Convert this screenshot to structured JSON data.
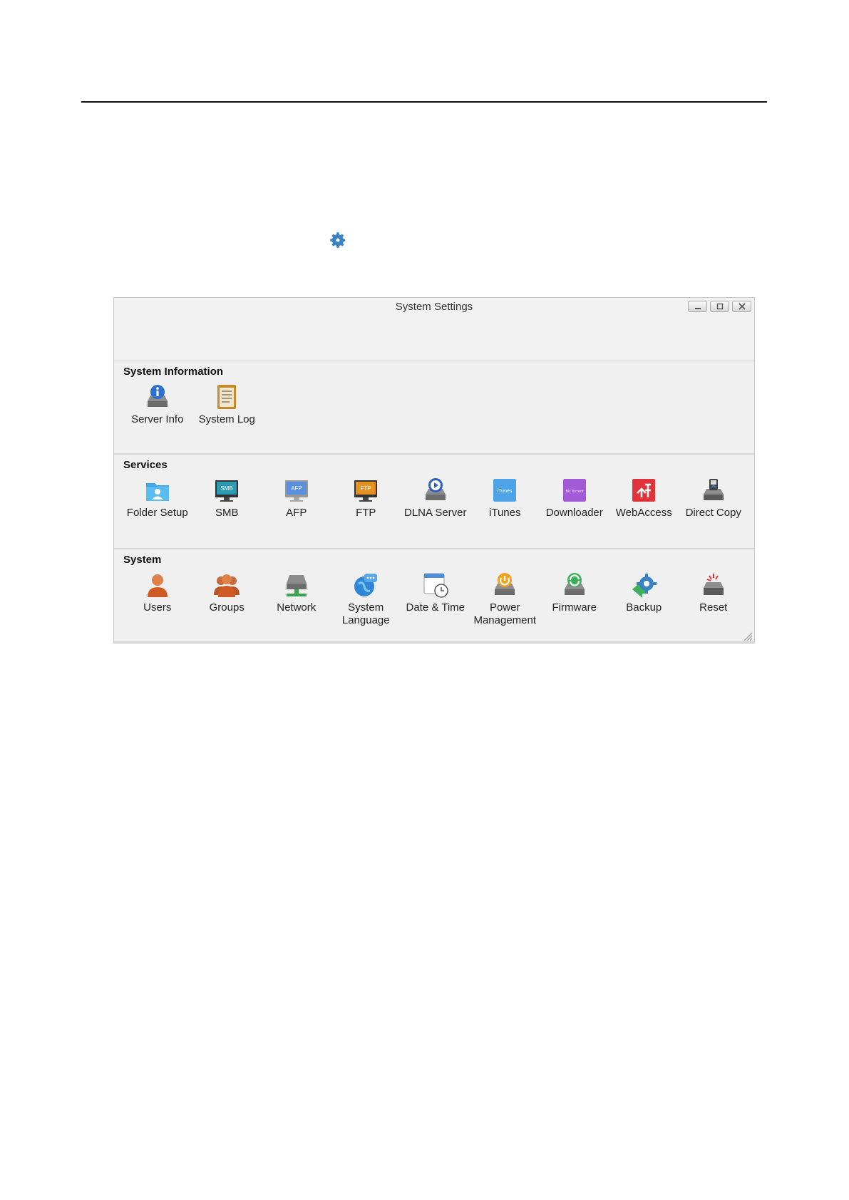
{
  "window": {
    "title": "System Settings",
    "controls": [
      "minimize",
      "maximize",
      "close"
    ]
  },
  "sections": {
    "system_information": {
      "title": "System Information",
      "items": [
        {
          "label": "Server Info",
          "icon": "server-info-icon"
        },
        {
          "label": "System Log",
          "icon": "system-log-icon"
        }
      ]
    },
    "services": {
      "title": "Services",
      "items": [
        {
          "label": "Folder Setup",
          "icon": "folder-setup-icon"
        },
        {
          "label": "SMB",
          "icon": "smb-icon",
          "icon_text": "SMB"
        },
        {
          "label": "AFP",
          "icon": "afp-icon",
          "icon_text": "AFP"
        },
        {
          "label": "FTP",
          "icon": "ftp-icon",
          "icon_text": "FTP"
        },
        {
          "label": "DLNA Server",
          "icon": "dlna-server-icon"
        },
        {
          "label": "iTunes",
          "icon": "itunes-icon",
          "icon_text": "iTunes"
        },
        {
          "label": "Downloader",
          "icon": "downloader-icon",
          "icon_text": "Bit Torrent"
        },
        {
          "label": "WebAccess",
          "icon": "webaccess-icon"
        },
        {
          "label": "Direct Copy",
          "icon": "direct-copy-icon"
        }
      ]
    },
    "system": {
      "title": "System",
      "items": [
        {
          "label": "Users",
          "icon": "users-icon"
        },
        {
          "label": "Groups",
          "icon": "groups-icon"
        },
        {
          "label": "Network",
          "icon": "network-icon"
        },
        {
          "label": "System Language",
          "label_lines": [
            "System",
            "Language"
          ],
          "icon": "system-language-icon"
        },
        {
          "label": "Date & Time",
          "icon": "date-time-icon"
        },
        {
          "label": "Power Management",
          "label_lines": [
            "Power",
            "Management"
          ],
          "icon": "power-management-icon"
        },
        {
          "label": "Firmware",
          "icon": "firmware-icon"
        },
        {
          "label": "Backup",
          "icon": "backup-icon"
        },
        {
          "label": "Reset",
          "icon": "reset-icon"
        }
      ]
    }
  },
  "colors": {
    "accent_blue": "#3b82c4",
    "window_bg": "#f0f0f0"
  }
}
